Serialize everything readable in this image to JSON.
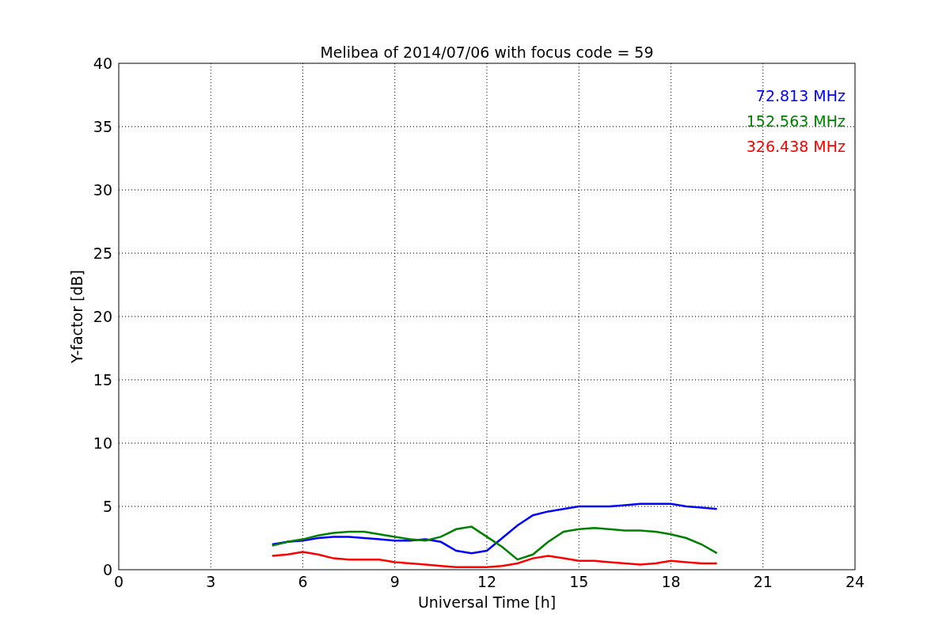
{
  "figure": {
    "chart_data": {
      "type": "line",
      "title": "Melibea of 2014/07/06 with focus code = 59",
      "xlabel": "Universal Time [h]",
      "ylabel": "Y-factor [dB]",
      "x": [
        5,
        5.5,
        6,
        6.5,
        7,
        7.5,
        8,
        8.5,
        9,
        9.5,
        10,
        10.5,
        11,
        11.5,
        12,
        12.5,
        13,
        13.5,
        14,
        14.5,
        15,
        15.5,
        16,
        16.5,
        17,
        17.5,
        18,
        18.5,
        19,
        19.5
      ],
      "series": [
        {
          "name": "72.813 MHz",
          "color": "#0000ff",
          "values": [
            2,
            2.2,
            2.3,
            2.5,
            2.6,
            2.6,
            2.5,
            2.4,
            2.3,
            2.3,
            2.4,
            2.2,
            1.5,
            1.3,
            1.5,
            2.5,
            3.5,
            4.3,
            4.6,
            4.8,
            5,
            5,
            5,
            5.1,
            5.2,
            5.2,
            5.2,
            5,
            4.9,
            4.8
          ]
        },
        {
          "name": "152.563 MHz",
          "color": "#008000",
          "values": [
            1.9,
            2.2,
            2.4,
            2.7,
            2.9,
            3,
            3,
            2.8,
            2.6,
            2.4,
            2.3,
            2.6,
            3.2,
            3.4,
            2.6,
            1.8,
            0.8,
            1.2,
            2.2,
            3,
            3.2,
            3.3,
            3.2,
            3.1,
            3.1,
            3,
            2.8,
            2.5,
            2,
            1.3
          ]
        },
        {
          "name": "326.438 MHz",
          "color": "#ff0000",
          "values": [
            1.1,
            1.2,
            1.4,
            1.2,
            0.9,
            0.8,
            0.8,
            0.8,
            0.6,
            0.5,
            0.4,
            0.3,
            0.2,
            0.2,
            0.2,
            0.3,
            0.5,
            0.9,
            1.1,
            0.9,
            0.7,
            0.7,
            0.6,
            0.5,
            0.4,
            0.5,
            0.7,
            0.6,
            0.5,
            0.5
          ]
        }
      ],
      "xlim": [
        0,
        24
      ],
      "ylim": [
        0,
        40
      ],
      "xticks": [
        0,
        3,
        6,
        9,
        12,
        15,
        18,
        21,
        24
      ],
      "yticks": [
        0,
        5,
        10,
        15,
        20,
        25,
        30,
        35,
        40
      ],
      "grid": true
    }
  }
}
